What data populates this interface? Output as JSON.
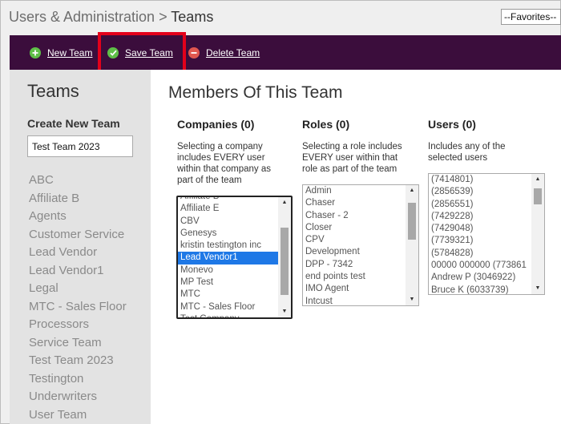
{
  "breadcrumb": {
    "parent": "Users & Administration",
    "separator": ">",
    "current": "Teams"
  },
  "favorites": {
    "selected": "--Favorites--"
  },
  "toolbar": {
    "new_team": "New Team",
    "save_team": "Save Team",
    "delete_team": "Delete Team"
  },
  "sidebar": {
    "title": "Teams",
    "create_label": "Create New Team",
    "team_name_value": "Test Team 2023",
    "teams": [
      "ABC",
      "Affiliate B",
      "Agents",
      "Customer Service",
      "Lead Vendor",
      "Lead Vendor1",
      "Legal",
      "MTC - Sales Floor",
      "Processors",
      "Service Team",
      "Test Team 2023",
      "Testington",
      "Underwriters",
      "User Team"
    ]
  },
  "main": {
    "title": "Members Of This Team",
    "companies": {
      "heading": "Companies (0)",
      "description": "Selecting a company includes EVERY user within that company as part of the team",
      "items": [
        "Affiliate B",
        "Affiliate E",
        "CBV",
        "Genesys",
        "kristin testington inc",
        "Lead Vendor1",
        "Monevo",
        "MP Test",
        "MTC",
        "MTC - Sales Floor",
        "Test Company"
      ],
      "selected": "Lead Vendor1"
    },
    "roles": {
      "heading": "Roles (0)",
      "description": "Selecting a role includes EVERY user within that role as part of the team",
      "items": [
        "Admin",
        "Chaser",
        "Chaser - 2",
        "Closer",
        "CPV",
        "Development",
        "DPP - 7342",
        "end points test",
        "IMO Agent",
        "Intcust"
      ]
    },
    "users": {
      "heading": "Users (0)",
      "description": "Includes any of the selected users",
      "items": [
        "(7414801)",
        "(2856539)",
        "(2856551)",
        "(7429228)",
        "(7429048)",
        "(7739321)",
        "(5784828)",
        "00000 000000 (773861",
        "Andrew P (3046922)",
        "Bruce K (6033739)"
      ]
    }
  }
}
